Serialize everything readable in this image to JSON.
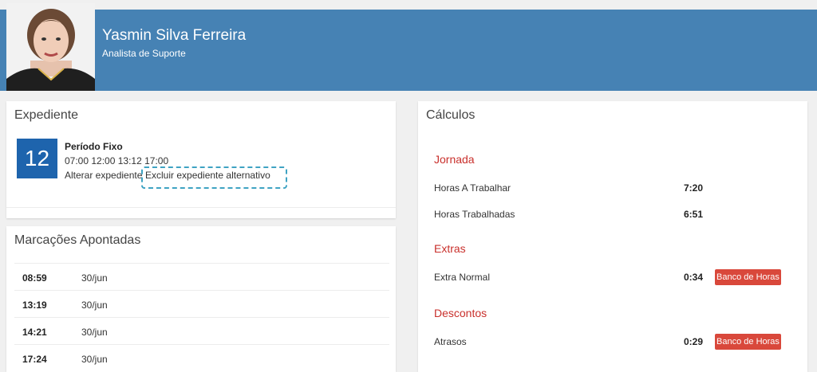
{
  "user": {
    "name": "Yasmin Silva Ferreira",
    "role": "Analista de Suporte"
  },
  "expediente": {
    "title": "Expediente",
    "day": "12",
    "periodo_title": "Período Fixo",
    "times": "07:00 12:00 13:12 17:00",
    "alterar_label": "Alterar expediente",
    "excluir_label": "Excluir expediente alternativo"
  },
  "marcacoes": {
    "title": "Marcações Apontadas",
    "rows": [
      {
        "time": "08:59",
        "date": "30/jun"
      },
      {
        "time": "13:19",
        "date": "30/jun"
      },
      {
        "time": "14:21",
        "date": "30/jun"
      },
      {
        "time": "17:24",
        "date": "30/jun"
      }
    ]
  },
  "calculos": {
    "title": "Cálculos",
    "jornada": {
      "title": "Jornada",
      "items": [
        {
          "label": "Horas A Trabalhar",
          "value": "7:20"
        },
        {
          "label": "Horas Trabalhadas",
          "value": "6:51"
        }
      ]
    },
    "extras": {
      "title": "Extras",
      "items": [
        {
          "label": "Extra Normal",
          "value": "0:34",
          "badge": "Banco de Horas"
        }
      ]
    },
    "descontos": {
      "title": "Descontos",
      "items": [
        {
          "label": "Atrasos",
          "value": "0:29",
          "badge": "Banco de Horas"
        }
      ]
    }
  },
  "colors": {
    "header": "#4682b4",
    "day_box": "#1e64ad",
    "section_title": "#c9302c",
    "badge": "#d9483b",
    "focus_outline": "#3fa3c3"
  }
}
